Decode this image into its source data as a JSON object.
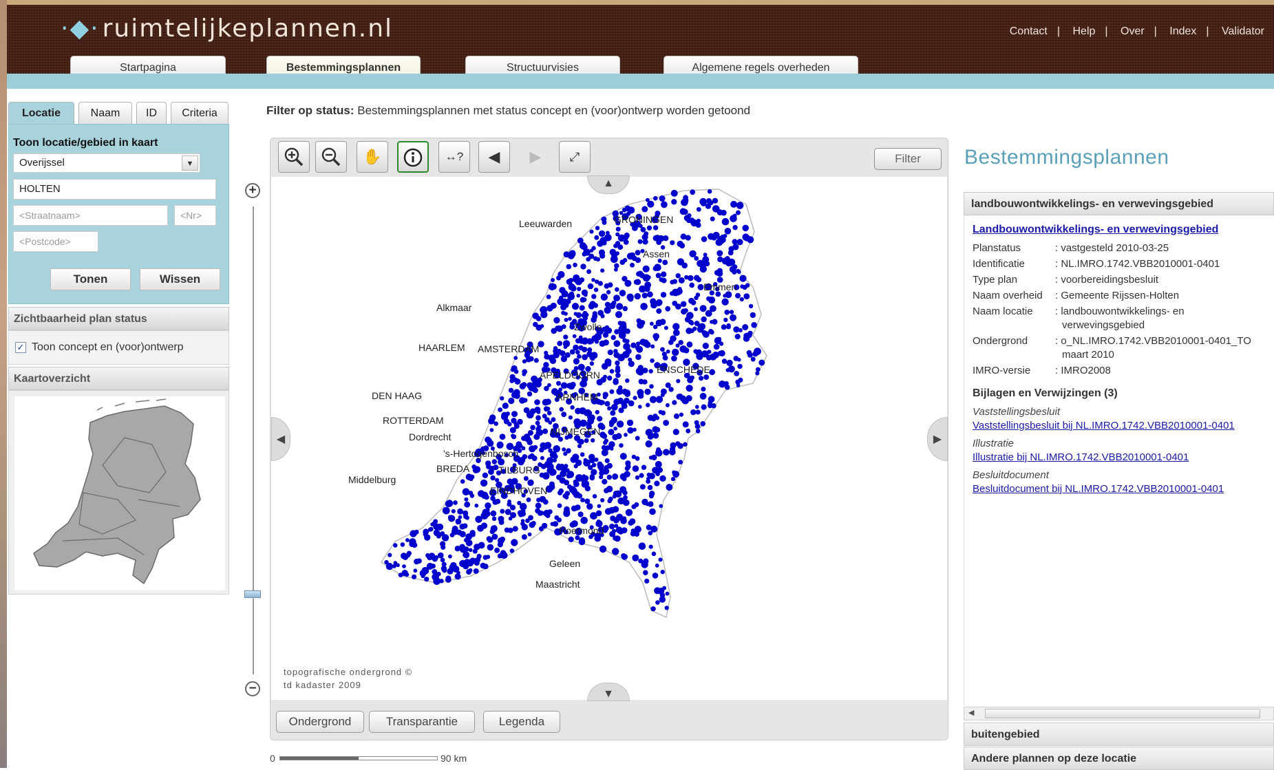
{
  "header": {
    "logo_text": "ruimtelijkeplannen.nl",
    "links": [
      "Contact",
      "Help",
      "Over",
      "Index",
      "Validator"
    ],
    "tabs": [
      "Startpagina",
      "Bestemmingsplannen",
      "Structuurvisies",
      "Algemene regels overheden"
    ],
    "active_tab": "Bestemmingsplannen"
  },
  "left": {
    "tabs": [
      "Locatie",
      "Naam",
      "ID",
      "Criteria"
    ],
    "location_title": "Toon locatie/gebied in kaart",
    "province": "Overijssel",
    "place": "HOLTEN",
    "street_placeholder": "<Straatnaam>",
    "nr_placeholder": "<Nr>",
    "postcode_placeholder": "<Postcode>",
    "btn_show": "Tonen",
    "btn_clear": "Wissen",
    "visibility_title": "Zichtbaarheid plan status",
    "visibility_option": "Toon concept en (voor)ontwerp",
    "overview_title": "Kaartoverzicht"
  },
  "filter": {
    "label": "Filter op status:",
    "text": "Bestemmingsplannen met status concept en (voor)ontwerp worden getoond"
  },
  "map": {
    "filter_button": "Filter",
    "tools": [
      "zoom-in",
      "zoom-out",
      "pan",
      "info",
      "measure",
      "back",
      "forward",
      "full-extent"
    ],
    "labels": [
      "Leeuwarden",
      "GRONINGEN",
      "Assen",
      "Emmen",
      "Zwolle",
      "Alkmaar",
      "HAARLEM",
      "AMSTERDAM",
      "APELDOORN",
      "ENSCHEDE",
      "DEN HAAG",
      "ROTTERDAM",
      "Dordrecht",
      "NIJMEGEN",
      "ARNHEM",
      "'s-Hertogenbosch",
      "TILBURG",
      "BREDA",
      "EINDHOVEN",
      "Middelburg",
      "Roermond",
      "Geleen",
      "Maastricht"
    ],
    "copyright": [
      "topografische ondergrond ©",
      "td kadaster 2009"
    ],
    "bottom_buttons": [
      "Ondergrond",
      "Transparantie",
      "Legenda"
    ],
    "scale_start": "0",
    "scale_end": "90 km",
    "dot_color": "#0000cc"
  },
  "right": {
    "title": "Bestemmingsplannen",
    "section1": "landbouwontwikkelings- en verwevingsgebied",
    "plan_link": "Landbouwontwikkelings- en verwevingsgebied",
    "rows": [
      {
        "k": "Planstatus",
        "v": ": vastgesteld 2010-03-25"
      },
      {
        "k": "Identificatie",
        "v": ": NL.IMRO.1742.VBB2010001-0401"
      },
      {
        "k": "Type plan",
        "v": ": voorbereidingsbesluit"
      },
      {
        "k": "Naam overheid",
        "v": ": Gemeente Rijssen-Holten"
      },
      {
        "k": "Naam locatie",
        "v": ": landbouwontwikkelings- en",
        "v2": "verwevingsgebied"
      },
      {
        "k": "Ondergrond",
        "v": ": o_NL.IMRO.1742.VBB2010001-0401_TO",
        "v2": "maart 2010"
      },
      {
        "k": "IMRO-versie",
        "v": ": IMRO2008"
      }
    ],
    "attachments_title": "Bijlagen en Verwijzingen (3)",
    "attachments": [
      {
        "type": "Vaststellingsbesluit",
        "link": "Vaststellingsbesluit bij NL.IMRO.1742.VBB2010001-0401"
      },
      {
        "type": "Illustratie",
        "link": "Illustratie bij NL.IMRO.1742.VBB2010001-0401"
      },
      {
        "type": "Besluitdocument",
        "link": "Besluitdocument bij NL.IMRO.1742.VBB2010001-0401"
      }
    ],
    "section2": "buitengebied",
    "section3": "Andere plannen op deze locatie"
  }
}
